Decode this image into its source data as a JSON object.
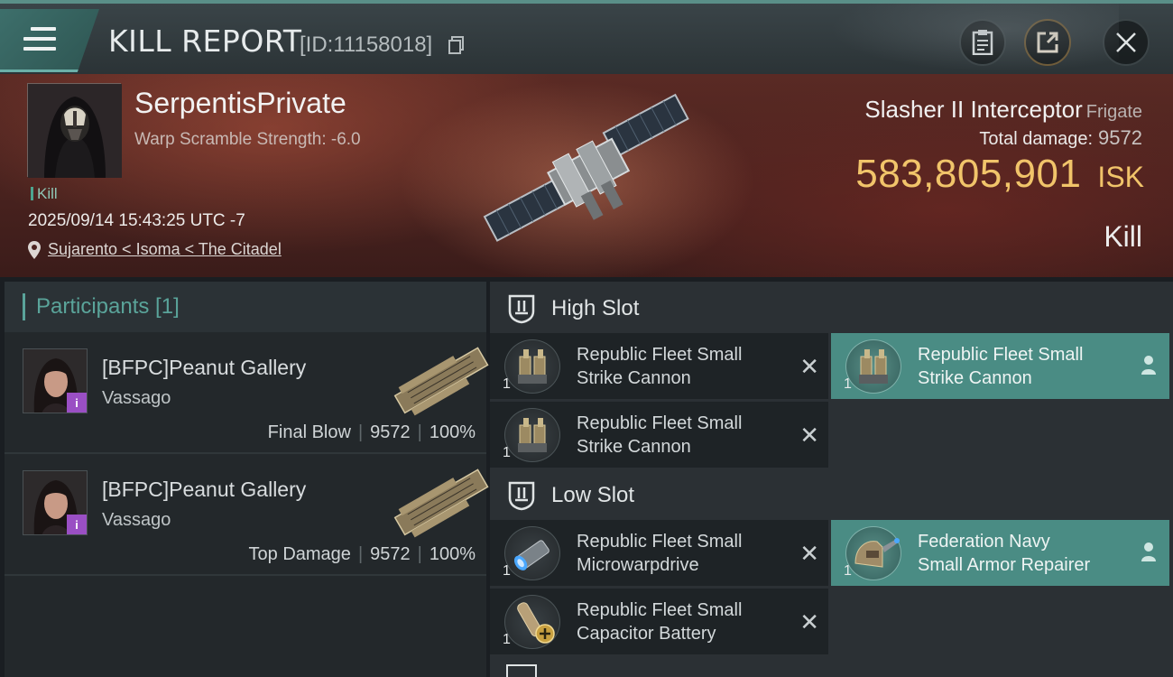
{
  "window": {
    "title": "KILL REPORT",
    "report_id": "[ID:11158018]",
    "icons": [
      "menu-icon",
      "copy-icon",
      "clipboard-icon",
      "share-icon",
      "close-icon"
    ]
  },
  "victim": {
    "pilot_name": "SerpentisPrivate",
    "warp_scramble": "Warp Scramble Strength: -6.0",
    "kill_tag": "Kill",
    "datetime": "2025/09/14 15:43:25 UTC -7",
    "location": "Sujarento < Isoma < The Citadel",
    "ship_name": "Slasher II Interceptor",
    "ship_class": "Frigate",
    "total_damage_label": "Total damage:",
    "total_damage": "9572",
    "isk_value": "583,805,901",
    "isk_unit": "ISK",
    "result": "Kill"
  },
  "participants": {
    "header": "Participants [1]",
    "items": [
      {
        "name": "[BFPC]Peanut Gallery",
        "ship": "Vassago",
        "role": "Final Blow",
        "damage": "9572",
        "percent": "100%",
        "badge": "i"
      },
      {
        "name": "[BFPC]Peanut Gallery",
        "ship": "Vassago",
        "role": "Top Damage",
        "damage": "9572",
        "percent": "100%",
        "badge": "i"
      }
    ]
  },
  "fitting": {
    "high_slot": {
      "title": "High Slot",
      "modules": [
        {
          "line1": "Republic Fleet Small",
          "line2": "Strike Cannon",
          "qty": "1",
          "state": "destroyed"
        },
        {
          "line1": "Republic Fleet Small",
          "line2": "Strike Cannon",
          "qty": "1",
          "state": "dropped"
        },
        {
          "line1": "Republic Fleet Small",
          "line2": "Strike Cannon",
          "qty": "1",
          "state": "destroyed"
        }
      ]
    },
    "low_slot": {
      "title": "Low Slot",
      "modules": [
        {
          "line1": "Republic Fleet Small",
          "line2": "Microwarpdrive",
          "qty": "1",
          "state": "destroyed"
        },
        {
          "line1": "Federation Navy",
          "line2": "Small Armor Repairer",
          "qty": "1",
          "state": "dropped"
        },
        {
          "line1": "Republic Fleet Small",
          "line2": "Capacitor Battery",
          "qty": "1",
          "state": "destroyed"
        }
      ]
    },
    "destroyed_mark": "✕"
  },
  "colors": {
    "accent": "#4a8c84",
    "isk": "#f1c46a",
    "badge": "#9a4fc4"
  }
}
